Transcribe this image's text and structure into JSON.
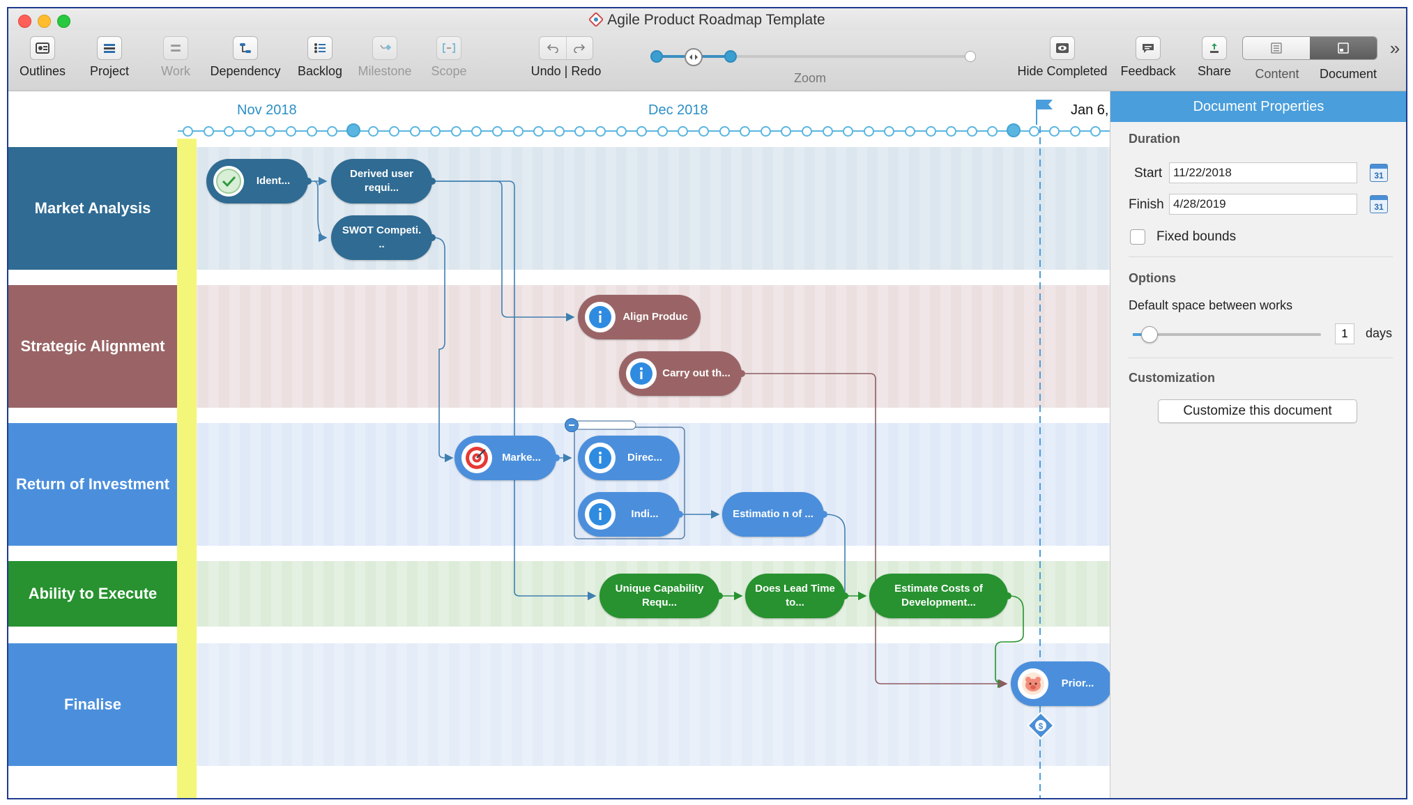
{
  "window": {
    "title": "Agile Product Roadmap Template"
  },
  "toolbar": {
    "outlines": "Outlines",
    "project": "Project",
    "work": "Work",
    "dependency": "Dependency",
    "backlog": "Backlog",
    "milestone": "Milestone",
    "scope": "Scope",
    "undo_redo": "Undo | Redo",
    "zoom": "Zoom",
    "hide_completed": "Hide Completed",
    "feedback": "Feedback",
    "share": "Share",
    "content": "Content",
    "document": "Document",
    "overflow": "»"
  },
  "timeline": {
    "months": [
      "Nov 2018",
      "Dec 2018",
      "Jan 6,"
    ]
  },
  "lanes": [
    {
      "label": "Market Analysis",
      "color": "#2f6b93",
      "tint": "#dbe6ee"
    },
    {
      "label": "Strategic Alignment",
      "color": "#9a6466",
      "tint": "#ecdfe0"
    },
    {
      "label": "Return of Investment",
      "color": "#4b8fdc",
      "tint": "#dfe9f8"
    },
    {
      "label": "Ability to Execute",
      "color": "#27922f",
      "tint": "#dcecd9"
    },
    {
      "label": "Finalise",
      "color": "#4b8fdc",
      "tint": "#e4ecf8"
    }
  ],
  "works": {
    "identify": "Ident...",
    "derived": "Derived user requi...",
    "swot": "SWOT Competi. ..",
    "align": "Align Produc",
    "carry": "Carry out th...",
    "market": "Marke...",
    "direc": "Direc...",
    "indi": "Indi...",
    "estimation": "Estimatio n of ...",
    "unique": "Unique Capability Requ...",
    "does": "Does Lead Time to...",
    "estimate_costs": "Estimate Costs of Development...",
    "prior": "Prior..."
  },
  "panel": {
    "title": "Document Properties",
    "duration_title": "Duration",
    "start_label": "Start",
    "start_value": "11/22/2018",
    "finish_label": "Finish",
    "finish_value": "4/28/2019",
    "calendar_day": "31",
    "fixed_bounds": "Fixed bounds",
    "options_title": "Options",
    "default_space_label": "Default space between works",
    "space_value": "1",
    "space_unit": "days",
    "customization_title": "Customization",
    "customize_button": "Customize this document"
  },
  "colors": {
    "accent": "#4a9edc",
    "timeline": "#5ab6e0",
    "today_marker": "#f4f67a"
  }
}
